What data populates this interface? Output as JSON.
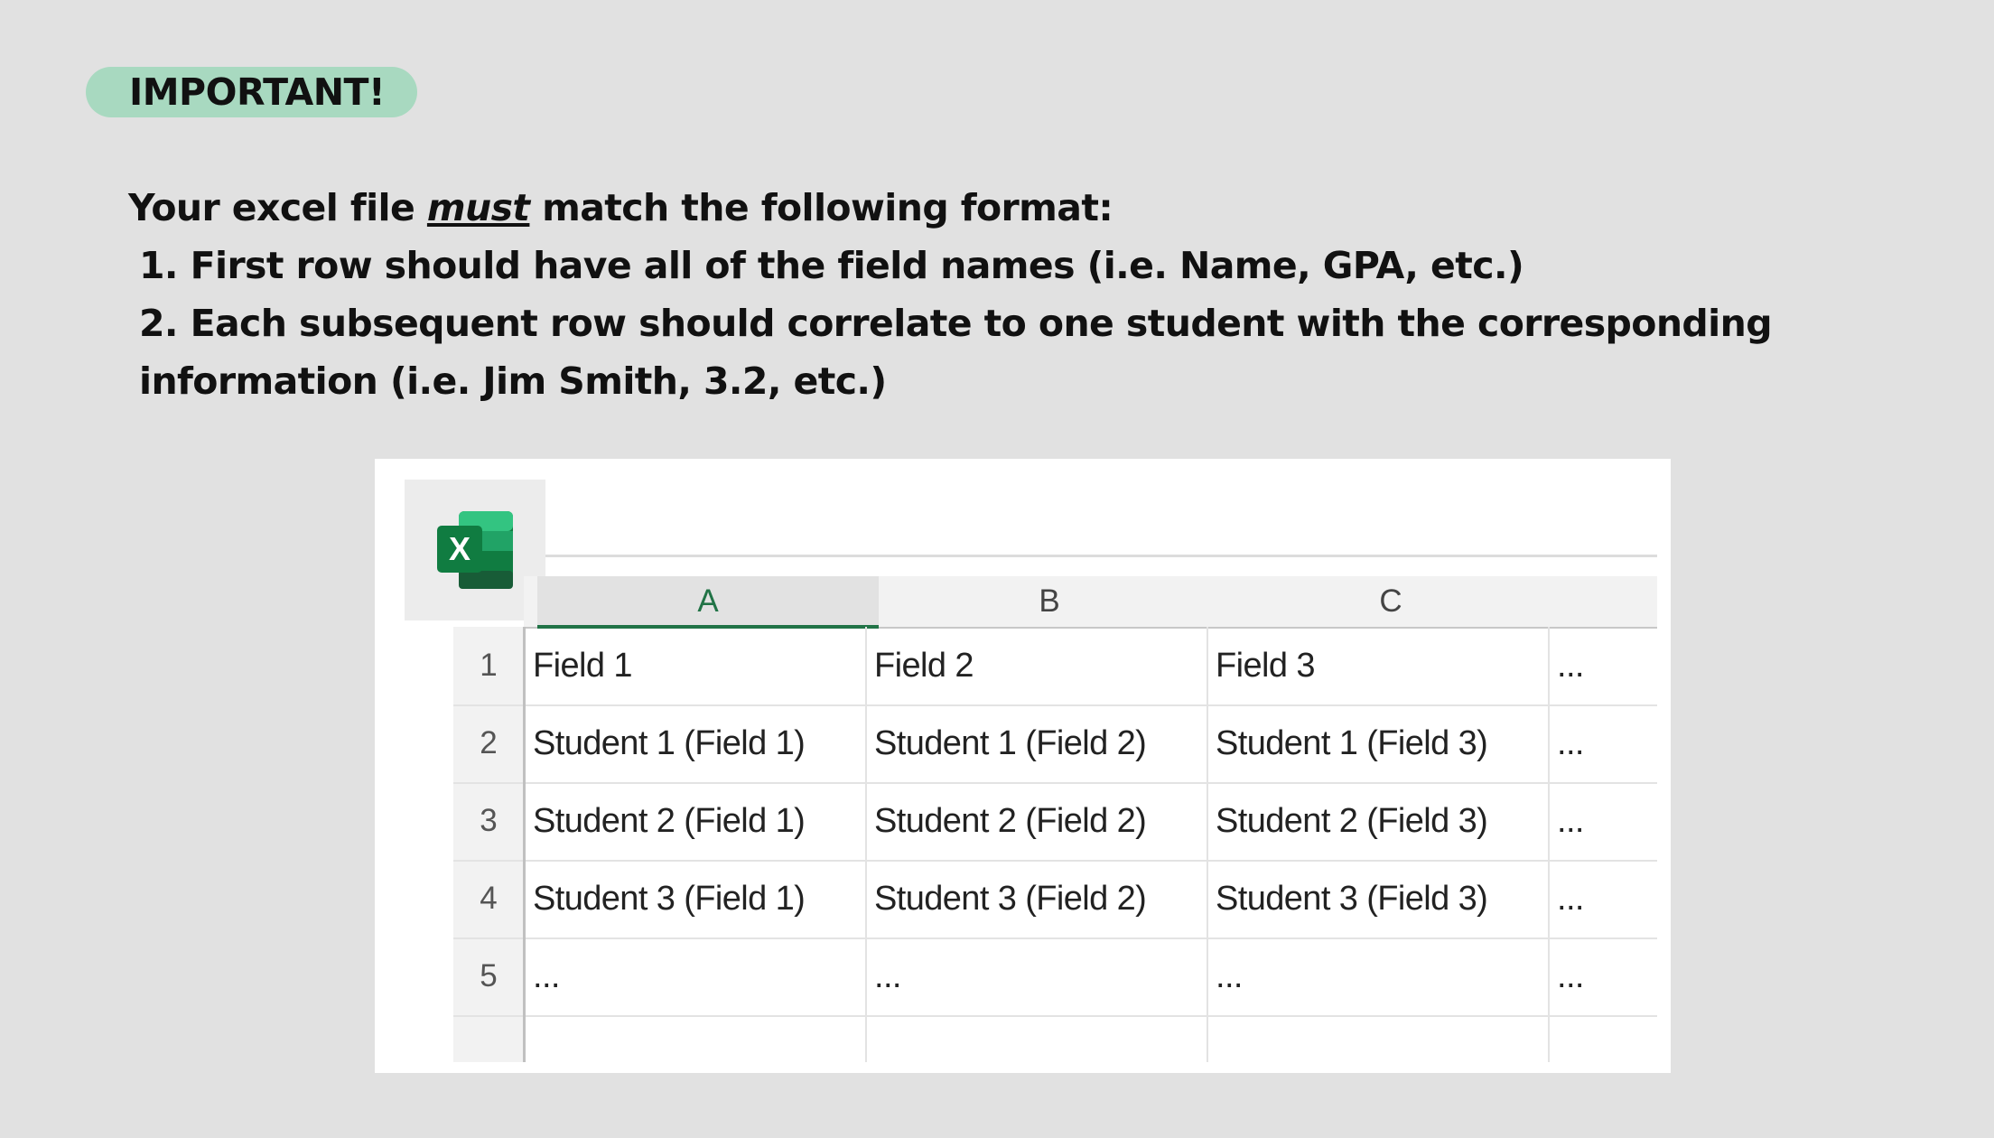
{
  "badge": "IMPORTANT!",
  "instructions": {
    "intro_before": "Your excel file ",
    "intro_emphasis": "must",
    "intro_after": " match the following format:",
    "item1": "1. First row should have all of the field names (i.e. Name, GPA, etc.)",
    "item2_line1": "2. Each subsequent row should correlate to one student with the corresponding",
    "item2_line2": "information (i.e. Jim Smith, 3.2, etc.)"
  },
  "app_icon": "excel-icon",
  "spreadsheet": {
    "selected_column": "A",
    "columns": [
      "A",
      "B",
      "C",
      ""
    ],
    "rows": [
      {
        "num": "1",
        "cells": [
          "Field 1",
          "Field 2",
          "Field 3",
          "..."
        ]
      },
      {
        "num": "2",
        "cells": [
          "Student 1 (Field 1)",
          "Student 1 (Field 2)",
          "Student 1 (Field 3)",
          "..."
        ]
      },
      {
        "num": "3",
        "cells": [
          "Student 2 (Field 1)",
          "Student 2 (Field 2)",
          "Student 2 (Field 3)",
          "..."
        ]
      },
      {
        "num": "4",
        "cells": [
          "Student 3 (Field 1)",
          "Student 3 (Field 2)",
          "Student 3 (Field 3)",
          "..."
        ]
      },
      {
        "num": "5",
        "cells": [
          "...",
          "...",
          "...",
          "..."
        ]
      }
    ]
  },
  "colors": {
    "badge_bg": "#a8d9c0",
    "excel_green": "#217346",
    "page_bg": "#e1e1e1"
  }
}
